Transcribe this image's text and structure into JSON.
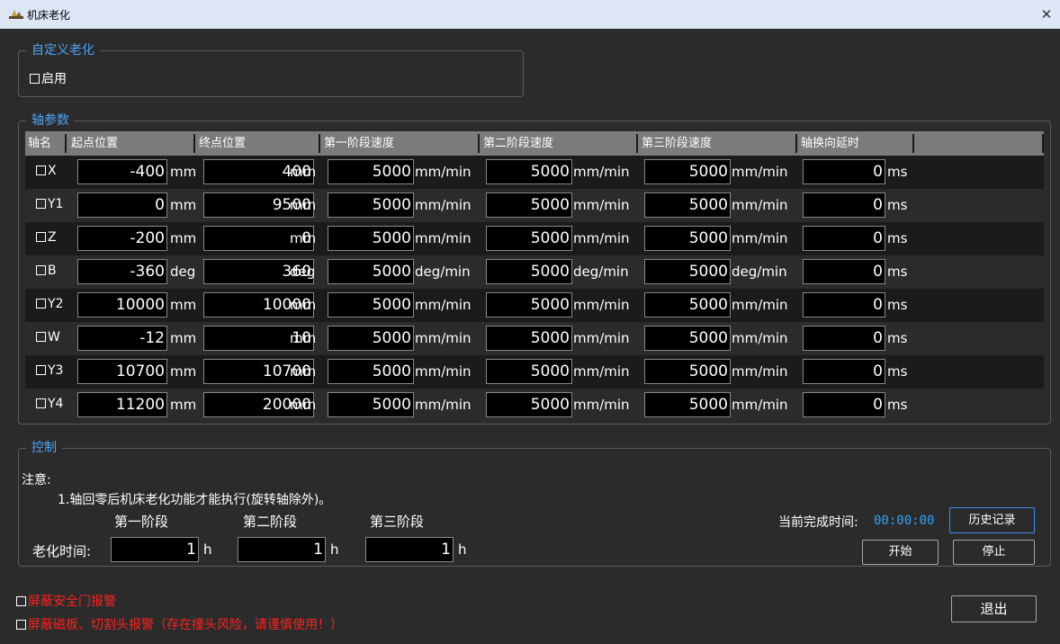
{
  "window": {
    "title": "机床老化",
    "close_glyph": "✕"
  },
  "custom_group": {
    "title": "自定义老化",
    "enable_label": "启用"
  },
  "axis_group": {
    "title": "轴参数",
    "headers": [
      "轴名",
      "起点位置",
      "终点位置",
      "第一阶段速度",
      "第二阶段速度",
      "第三阶段速度",
      "轴换向延时"
    ],
    "rows": [
      {
        "axis": "X",
        "start": "-400",
        "start_unit": "mm",
        "end": "400",
        "end_unit": "mm",
        "s1": "5000",
        "s2": "5000",
        "s3": "5000",
        "speed_unit": "mm/min",
        "delay": "0",
        "delay_unit": "ms"
      },
      {
        "axis": "Y1",
        "start": "0",
        "start_unit": "mm",
        "end": "9500",
        "end_unit": "mm",
        "s1": "5000",
        "s2": "5000",
        "s3": "5000",
        "speed_unit": "mm/min",
        "delay": "0",
        "delay_unit": "ms"
      },
      {
        "axis": "Z",
        "start": "-200",
        "start_unit": "mm",
        "end": "0",
        "end_unit": "mm",
        "s1": "5000",
        "s2": "5000",
        "s3": "5000",
        "speed_unit": "mm/min",
        "delay": "0",
        "delay_unit": "ms"
      },
      {
        "axis": "B",
        "start": "-360",
        "start_unit": "deg",
        "end": "360",
        "end_unit": "deg",
        "s1": "5000",
        "s2": "5000",
        "s3": "5000",
        "speed_unit": "deg/min",
        "delay": "0",
        "delay_unit": "ms"
      },
      {
        "axis": "Y2",
        "start": "10000",
        "start_unit": "mm",
        "end": "10000",
        "end_unit": "mm",
        "s1": "5000",
        "s2": "5000",
        "s3": "5000",
        "speed_unit": "mm/min",
        "delay": "0",
        "delay_unit": "ms"
      },
      {
        "axis": "W",
        "start": "-12",
        "start_unit": "mm",
        "end": "10",
        "end_unit": "mm",
        "s1": "5000",
        "s2": "5000",
        "s3": "5000",
        "speed_unit": "mm/min",
        "delay": "0",
        "delay_unit": "ms"
      },
      {
        "axis": "Y3",
        "start": "10700",
        "start_unit": "mm",
        "end": "10700",
        "end_unit": "mm",
        "s1": "5000",
        "s2": "5000",
        "s3": "5000",
        "speed_unit": "mm/min",
        "delay": "0",
        "delay_unit": "ms"
      },
      {
        "axis": "Y4",
        "start": "11200",
        "start_unit": "mm",
        "end": "20000",
        "end_unit": "mm",
        "s1": "5000",
        "s2": "5000",
        "s3": "5000",
        "speed_unit": "mm/min",
        "delay": "0",
        "delay_unit": "ms"
      }
    ]
  },
  "control_group": {
    "title": "控制",
    "note_label": "注意:",
    "note_line1": "1.轴回零后机床老化功能才能执行(旋转轴除外)。",
    "stage_labels": [
      "第一阶段",
      "第二阶段",
      "第三阶段"
    ],
    "aging_time_label": "老化时间:",
    "aging_times": [
      "1",
      "1",
      "1"
    ],
    "time_unit": "h",
    "current_time_label": "当前完成时间:",
    "current_time_value": "00:00:00",
    "history_button": "历史记录",
    "start_button": "开始",
    "stop_button": "停止"
  },
  "warnings": {
    "door_alarm": "屏蔽安全门报警",
    "tool_alarm": "屏蔽磁板、切割头报警（存在撞头风险，请谨慎使用！）"
  },
  "exit_button": "退出",
  "colors": {
    "accent": "#4ea3f4",
    "warning": "#ff2020",
    "time": "#2fa5ff",
    "titlebar": "#dce6f4"
  }
}
